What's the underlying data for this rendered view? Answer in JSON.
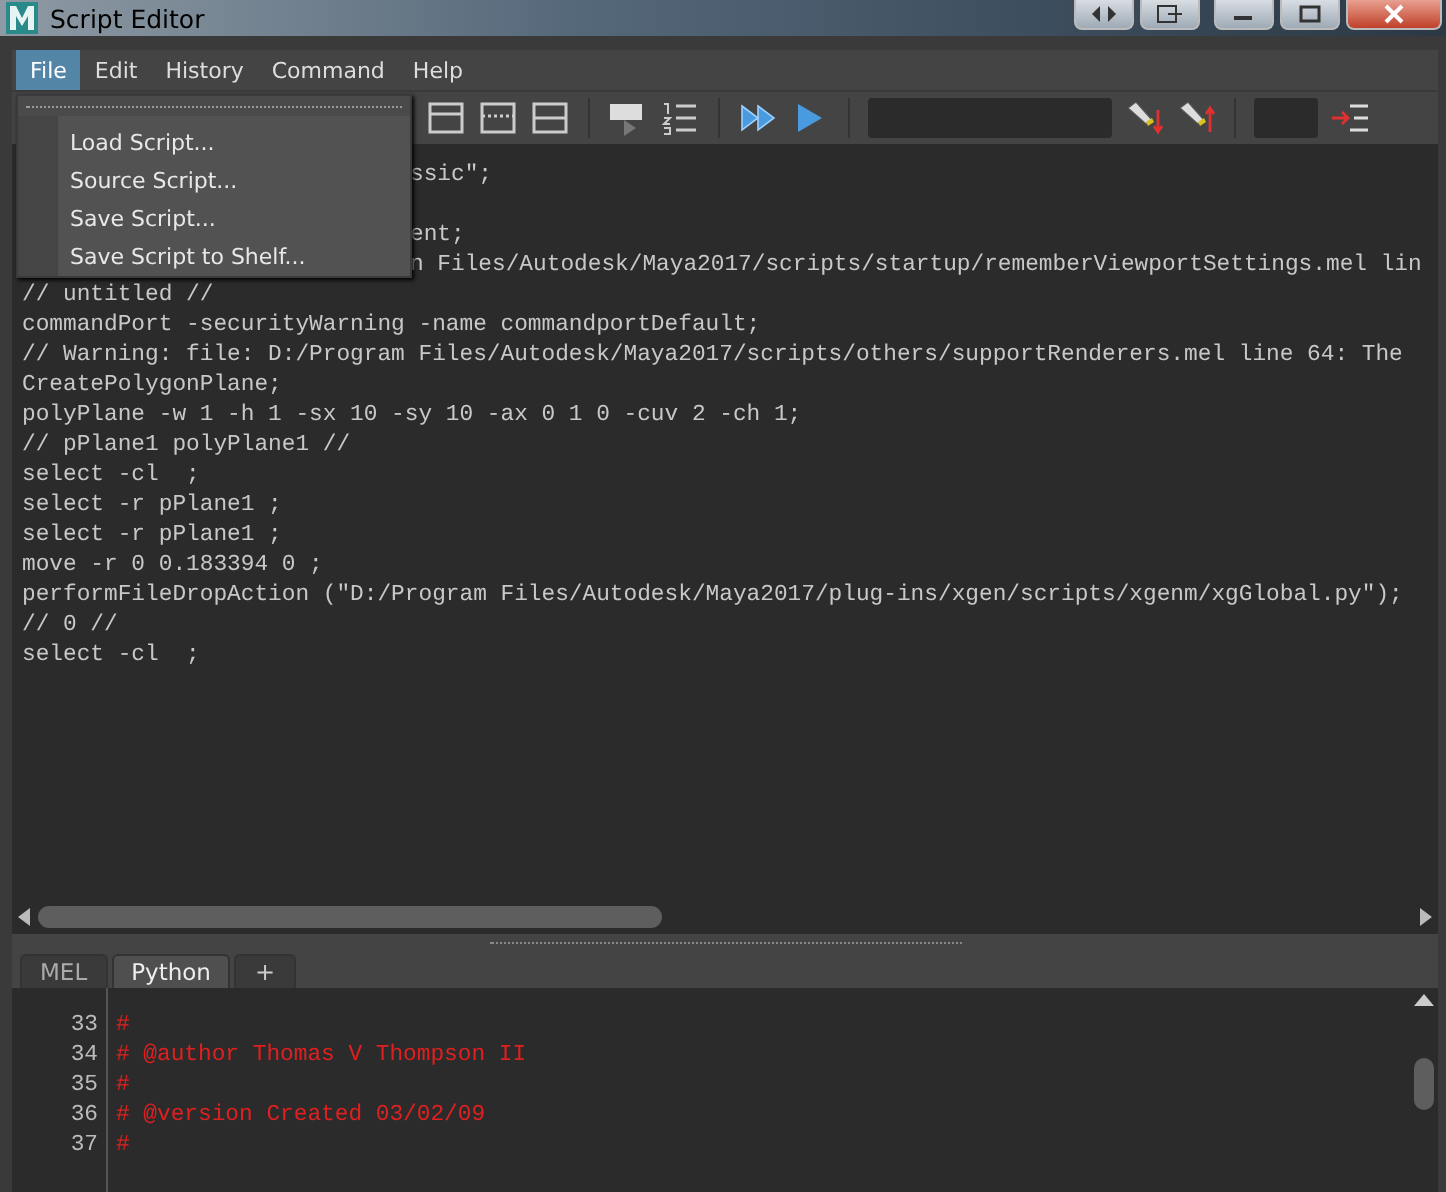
{
  "window": {
    "title": "Script Editor"
  },
  "menu_bar": [
    {
      "label": "File",
      "selected": true
    },
    {
      "label": "Edit",
      "selected": false
    },
    {
      "label": "History",
      "selected": false
    },
    {
      "label": "Command",
      "selected": false
    },
    {
      "label": "Help",
      "selected": false
    }
  ],
  "file_menu": {
    "items": [
      "Load Script...",
      "Source Script...",
      "Save Script...",
      "Save Script to Shelf..."
    ]
  },
  "output": {
    "lines": [
      {
        "kind": "covered",
        "text": "ssic\";"
      },
      {
        "kind": "blank"
      },
      {
        "kind": "covered",
        "text": "ent;"
      },
      {
        "kind": "covered",
        "text": "n Files/Autodesk/Maya2017/scripts/startup/rememberViewportSettings.mel lin"
      },
      {
        "kind": "full",
        "text": "// untitled //"
      },
      {
        "kind": "full",
        "text": "commandPort -securityWarning -name commandportDefault;"
      },
      {
        "kind": "full",
        "text": "// Warning: file: D:/Program Files/Autodesk/Maya2017/scripts/others/supportRenderers.mel line 64: The"
      },
      {
        "kind": "full",
        "text": "CreatePolygonPlane;"
      },
      {
        "kind": "full",
        "text": "polyPlane -w 1 -h 1 -sx 10 -sy 10 -ax 0 1 0 -cuv 2 -ch 1;"
      },
      {
        "kind": "full",
        "text": "// pPlane1 polyPlane1 //"
      },
      {
        "kind": "full",
        "text": "select -cl  ;"
      },
      {
        "kind": "full",
        "text": "select -r pPlane1 ;"
      },
      {
        "kind": "full",
        "text": "select -r pPlane1 ;"
      },
      {
        "kind": "full",
        "text": "move -r 0 0.183394 0 ;"
      },
      {
        "kind": "full",
        "text": "performFileDropAction (\"D:/Program Files/Autodesk/Maya2017/plug-ins/xgen/scripts/xgenm/xgGlobal.py\");"
      },
      {
        "kind": "full",
        "text": "// 0 //"
      },
      {
        "kind": "full",
        "text": "select -cl  ;"
      }
    ]
  },
  "tabs": [
    {
      "label": "MEL",
      "selected": false
    },
    {
      "label": "Python",
      "selected": true
    }
  ],
  "add_tab_button": "+",
  "editor": {
    "lines": [
      {
        "number": "33",
        "text": "#"
      },
      {
        "number": "34",
        "text": "# @author Thomas V Thompson II"
      },
      {
        "number": "35",
        "text": "#"
      },
      {
        "number": "36",
        "text": "# @version Created 03/02/09"
      },
      {
        "number": "37",
        "text": "#"
      }
    ]
  }
}
